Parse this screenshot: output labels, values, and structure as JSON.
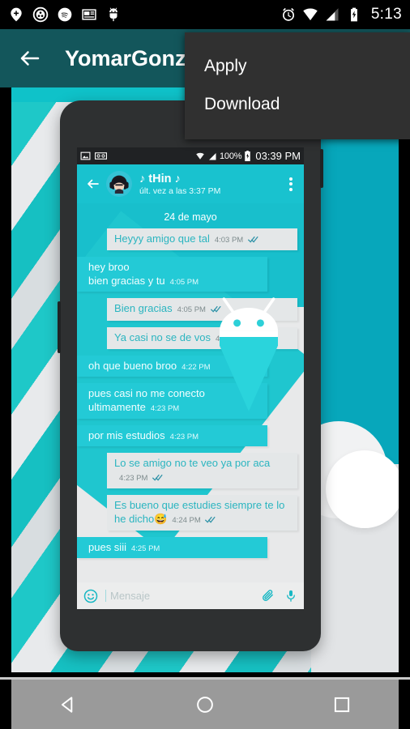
{
  "system_status_bar": {
    "icons": [
      "location-pin-plus-icon",
      "circle-dots-icon",
      "spotify-icon",
      "news-layout-icon",
      "android-bug-icon"
    ],
    "alarm_icon": "alarm-clock-icon",
    "wifi_icon": "wifi-icon",
    "signal_icon": "cell-signal-icon",
    "battery_icon": "battery-charging-icon",
    "clock": "5:13"
  },
  "toolbar": {
    "back_icon": "back-arrow-icon",
    "title": "YomarGonza"
  },
  "overflow_menu": {
    "items": [
      {
        "label": "Apply"
      },
      {
        "label": "Download"
      }
    ]
  },
  "preview": {
    "phone_mockup": {
      "inner_status_bar": {
        "left_icons": [
          "screenshot-image-icon",
          "voicemail-icon"
        ],
        "wifi_icon": "wifi-icon",
        "signal_icon": "cell-signal-icon",
        "battery_percent": "100%",
        "battery_icon": "battery-charging-icon",
        "clock": "03:39 PM"
      },
      "chat_header": {
        "back_icon": "back-arrow-icon",
        "avatar": "contact-avatar",
        "contact_name": "♪ tHin ♪",
        "last_seen": "últ. vez a las 3:37 PM",
        "overflow_icon": "more-vertical-icon"
      },
      "chat": {
        "date_divider": "24 de mayo",
        "watermark": "android-robot-watermark",
        "messages": [
          {
            "dir": "out",
            "text": "Heyyy amigo que tal",
            "time": "4:03 PM",
            "read": true
          },
          {
            "dir": "in",
            "text": "hey broo\nbien gracias y tu",
            "time": "4:05 PM",
            "read": false
          },
          {
            "dir": "out",
            "text": "Bien gracias",
            "time": "4:05 PM",
            "read": true
          },
          {
            "dir": "out",
            "text": "Ya casi no se de vos",
            "time": "4:06 PM",
            "read": true
          },
          {
            "dir": "in",
            "text": "oh que bueno broo",
            "time": "4:22 PM",
            "read": false
          },
          {
            "dir": "in",
            "text": "pues casi no me conecto\nultimamente",
            "time": "4:23 PM",
            "read": false
          },
          {
            "dir": "in",
            "text": "por mis estudios",
            "time": "4:23 PM",
            "read": false
          },
          {
            "dir": "out",
            "text": "Lo se amigo no te veo ya por aca",
            "time": "4:23 PM",
            "read": true
          },
          {
            "dir": "out",
            "text": "Es bueno que estudies siempre te lo he dicho😅",
            "time": "4:24 PM",
            "read": true
          },
          {
            "dir": "in",
            "text": "pues siii",
            "time": "4:25 PM",
            "read": false
          }
        ],
        "input": {
          "emoji_icon": "emoji-smiley-icon",
          "placeholder": "Mensaje",
          "attach_icon": "paperclip-icon",
          "mic_icon": "microphone-icon"
        }
      }
    }
  },
  "nav_bar": {
    "back": "nav-back-icon",
    "home": "nav-home-icon",
    "recents": "nav-recents-icon"
  },
  "colors": {
    "toolbar": "#13565b",
    "accent_teal": "#19c2cf",
    "menu_bg": "#303030",
    "nav_bg": "#9a9a9a"
  }
}
